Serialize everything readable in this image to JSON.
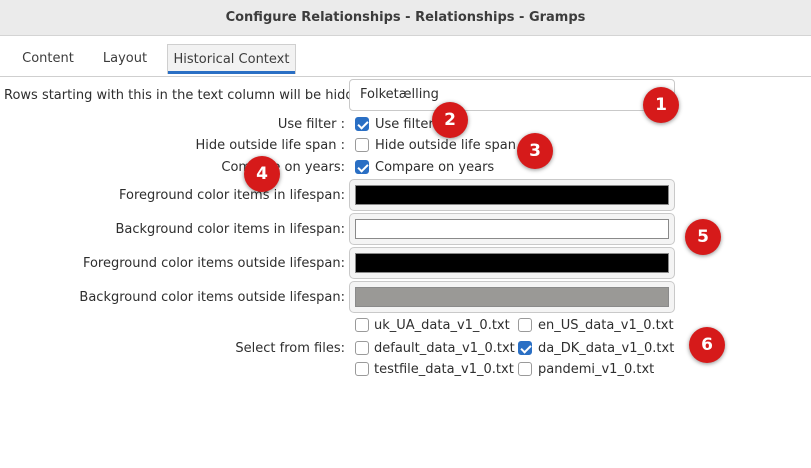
{
  "window": {
    "title": "Configure Relationships - Relationships - Gramps"
  },
  "tabs": [
    {
      "label": "Content"
    },
    {
      "label": "Layout"
    },
    {
      "label": "Historical Context"
    }
  ],
  "form": {
    "hidden_rows_label": "Rows starting with this in the text column will be hidden :",
    "hidden_rows_value": "Folketælling",
    "use_filter_label": "Use filter :",
    "use_filter_check": "Use filter",
    "use_filter_checked": true,
    "hide_outside_label": "Hide outside life span :",
    "hide_outside_check": "Hide outside life span",
    "hide_outside_checked": false,
    "compare_years_label": "Compare on years:",
    "compare_years_check": "Compare on years",
    "compare_years_checked": true,
    "fg_in_label": "Foreground color items in lifespan:",
    "fg_in_color": "#000000",
    "bg_in_label": "Background color items in lifespan:",
    "bg_in_color": "#ffffff",
    "fg_out_label": "Foreground color items outside lifespan:",
    "fg_out_color": "#000000",
    "bg_out_label": "Background color items outside lifespan:",
    "bg_out_color": "#9a9996",
    "files_label": "Select from files:",
    "files": [
      {
        "name": "uk_UA_data_v1_0.txt",
        "checked": false
      },
      {
        "name": "en_US_data_v1_0.txt",
        "checked": false
      },
      {
        "name": "default_data_v1_0.txt",
        "checked": false
      },
      {
        "name": "da_DK_data_v1_0.txt",
        "checked": true
      },
      {
        "name": "testfile_data_v1_0.txt",
        "checked": false
      },
      {
        "name": "pandemi_v1_0.txt",
        "checked": false
      }
    ]
  },
  "badges": [
    "1",
    "2",
    "3",
    "4",
    "5",
    "6"
  ],
  "colors": {
    "accent": "#2a6fc4",
    "badge": "#d61a1a"
  }
}
